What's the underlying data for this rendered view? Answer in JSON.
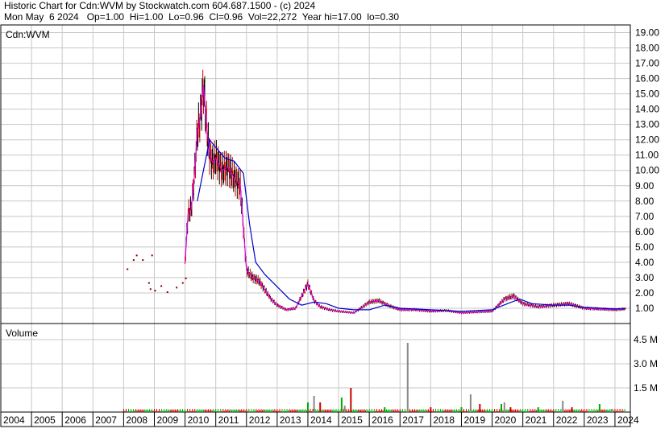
{
  "header": {
    "line1": "Historic Chart for Cdn:WVM by Stockwatch.com 604.687.1500 - (c) 2024",
    "line2": "Mon May  6 2024   Op=1.00  Hi=1.00  Lo=0.96  Cl=0.96  Vol=22,272  Year hi=17.00  lo=0.30"
  },
  "price_panel": {
    "label": "Cdn:WVM"
  },
  "volume_panel": {
    "label": "Volume"
  },
  "chart_data": [
    {
      "type": "line",
      "title": "Cdn:WVM",
      "x_axis_years": [
        "2004",
        "2005",
        "2006",
        "2007",
        "2008",
        "2009",
        "2010",
        "2011",
        "2012",
        "2013",
        "2014",
        "2015",
        "2016",
        "2017",
        "2018",
        "2019",
        "2020",
        "2021",
        "2022",
        "2023",
        "2024"
      ],
      "y_ticks": [
        "19.00",
        "18.00",
        "17.00",
        "16.00",
        "15.00",
        "14.00",
        "13.00",
        "12.00",
        "11.00",
        "10.00",
        "9.00",
        "8.00",
        "7.00",
        "6.00",
        "5.00",
        "4.00",
        "3.00",
        "2.00",
        "1.00"
      ],
      "ylim": [
        0,
        19.5
      ],
      "grid": true,
      "series": [
        {
          "values_t": [
            2010.0,
            2010.1,
            2010.2,
            2010.3,
            2010.4,
            2010.5,
            2010.6,
            2010.7,
            2010.8,
            2010.9,
            2011.0,
            2011.2,
            2011.4,
            2011.6,
            2011.8,
            2012.0,
            2012.2,
            2012.4,
            2012.6,
            2012.8,
            2013.0,
            2013.3,
            2013.6,
            2014.0,
            2014.2,
            2014.4,
            2014.7,
            2015.0,
            2015.5,
            2016.0,
            2016.3,
            2016.6,
            2017.0,
            2017.5,
            2018.0,
            2018.5,
            2019.0,
            2019.5,
            2020.0,
            2020.4,
            2020.7,
            2021.0,
            2021.5,
            2022.0,
            2022.5,
            2023.0,
            2023.5,
            2024.0,
            2024.35
          ],
          "values": [
            4.0,
            7.2,
            7.5,
            9.5,
            12.5,
            13.5,
            15.5,
            13.0,
            11.0,
            10.5,
            10.8,
            10.0,
            10.2,
            9.5,
            9.0,
            3.5,
            3.0,
            2.8,
            2.2,
            1.6,
            1.2,
            0.9,
            1.0,
            2.6,
            1.5,
            1.1,
            0.9,
            0.8,
            0.7,
            1.4,
            1.5,
            1.2,
            0.9,
            0.9,
            0.8,
            0.85,
            0.7,
            0.75,
            0.8,
            1.6,
            1.8,
            1.3,
            1.1,
            1.2,
            1.3,
            1.0,
            0.95,
            0.9,
            0.96
          ]
        },
        {
          "values_t": [
            2010.4,
            2010.6,
            2010.8,
            2011.0,
            2011.3,
            2011.6,
            2011.9,
            2012.1,
            2012.3,
            2012.6,
            2013.0,
            2013.4,
            2013.8,
            2014.2,
            2014.6,
            2015.0,
            2015.5,
            2016.0,
            2016.5,
            2017.0,
            2018.0,
            2019.0,
            2019.5,
            2020.0,
            2020.5,
            2020.9,
            2021.3,
            2022.0,
            2022.5,
            2023.0,
            2024.0,
            2024.35
          ],
          "values": [
            8.0,
            10.0,
            12.0,
            11.5,
            10.8,
            10.6,
            9.8,
            6.5,
            4.0,
            3.2,
            2.4,
            1.6,
            1.2,
            1.4,
            1.3,
            1.0,
            0.9,
            0.9,
            1.2,
            1.0,
            0.9,
            0.8,
            0.85,
            0.9,
            1.3,
            1.6,
            1.3,
            1.2,
            1.2,
            1.05,
            0.95,
            0.96
          ]
        }
      ],
      "volume": {
        "title": "Volume",
        "y_ticks": [
          "4.5 M",
          "3.0 M",
          "1.5 M"
        ],
        "ylim": [
          0,
          5.5
        ],
        "bars_t": [
          2014.0,
          2014.2,
          2014.4,
          2015.1,
          2015.2,
          2015.4,
          2016.5,
          2017.25,
          2018.0,
          2019.0,
          2019.3,
          2019.6,
          2020.3,
          2020.4,
          2020.6,
          2021.5,
          2022.3,
          2022.6,
          2023.5,
          2023.9
        ],
        "bars": [
          0.6,
          1.0,
          0.6,
          0.9,
          0.4,
          1.5,
          0.3,
          4.3,
          0.3,
          0.3,
          1.1,
          0.5,
          0.5,
          0.6,
          0.3,
          0.3,
          0.7,
          0.3,
          0.5,
          0.2
        ]
      }
    }
  ]
}
